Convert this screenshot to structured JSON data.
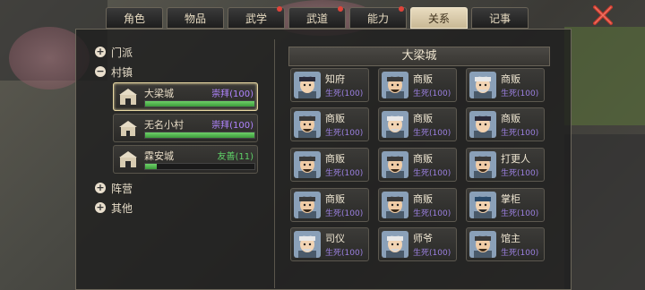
{
  "tabs": [
    {
      "label": "角色",
      "active": false,
      "dot": false
    },
    {
      "label": "物品",
      "active": false,
      "dot": false
    },
    {
      "label": "武学",
      "active": false,
      "dot": true
    },
    {
      "label": "武道",
      "active": false,
      "dot": true
    },
    {
      "label": "能力",
      "active": false,
      "dot": true
    },
    {
      "label": "关系",
      "active": true,
      "dot": false
    },
    {
      "label": "记事",
      "active": false,
      "dot": false
    }
  ],
  "tree": {
    "groups": [
      "门派",
      "村镇",
      "阵营",
      "其他"
    ],
    "cities": [
      {
        "name": "大梁城",
        "relation": "崇拜(100)",
        "relation_color": "#b084ff",
        "progress": 1.0,
        "selected": true
      },
      {
        "name": "无名小村",
        "relation": "崇拜(100)",
        "relation_color": "#b084ff",
        "progress": 1.0,
        "selected": false
      },
      {
        "name": "霖安城",
        "relation": "友善(11)",
        "relation_color": "#5ecf67",
        "progress": 0.11,
        "selected": false
      }
    ]
  },
  "right": {
    "title": "大梁城",
    "npcs": [
      {
        "role": "知府",
        "stat": "生死(100)",
        "face": "official"
      },
      {
        "role": "商贩",
        "stat": "生死(100)",
        "face": "merchant"
      },
      {
        "role": "商贩",
        "stat": "生死(100)",
        "face": "elder"
      },
      {
        "role": "商贩",
        "stat": "生死(100)",
        "face": "merchant"
      },
      {
        "role": "商贩",
        "stat": "生死(100)",
        "face": "elder"
      },
      {
        "role": "商贩",
        "stat": "生死(100)",
        "face": "official"
      },
      {
        "role": "商贩",
        "stat": "生死(100)",
        "face": "merchant"
      },
      {
        "role": "商贩",
        "stat": "生死(100)",
        "face": "merchant"
      },
      {
        "role": "打更人",
        "stat": "生死(100)",
        "face": "merchant"
      },
      {
        "role": "商贩",
        "stat": "生死(100)",
        "face": "merchant"
      },
      {
        "role": "商贩",
        "stat": "生死(100)",
        "face": "merchant"
      },
      {
        "role": "掌柜",
        "stat": "生死(100)",
        "face": "scholar"
      },
      {
        "role": "司仪",
        "stat": "生死(100)",
        "face": "elder"
      },
      {
        "role": "师爷",
        "stat": "生死(100)",
        "face": "elder"
      },
      {
        "role": "馆主",
        "stat": "生死(100)",
        "face": "merchant"
      }
    ]
  },
  "colors": {
    "accent": "#e9dcc0",
    "relation_purple": "#b084ff",
    "relation_green": "#5ecf67",
    "close_red": "#c83a2e"
  }
}
